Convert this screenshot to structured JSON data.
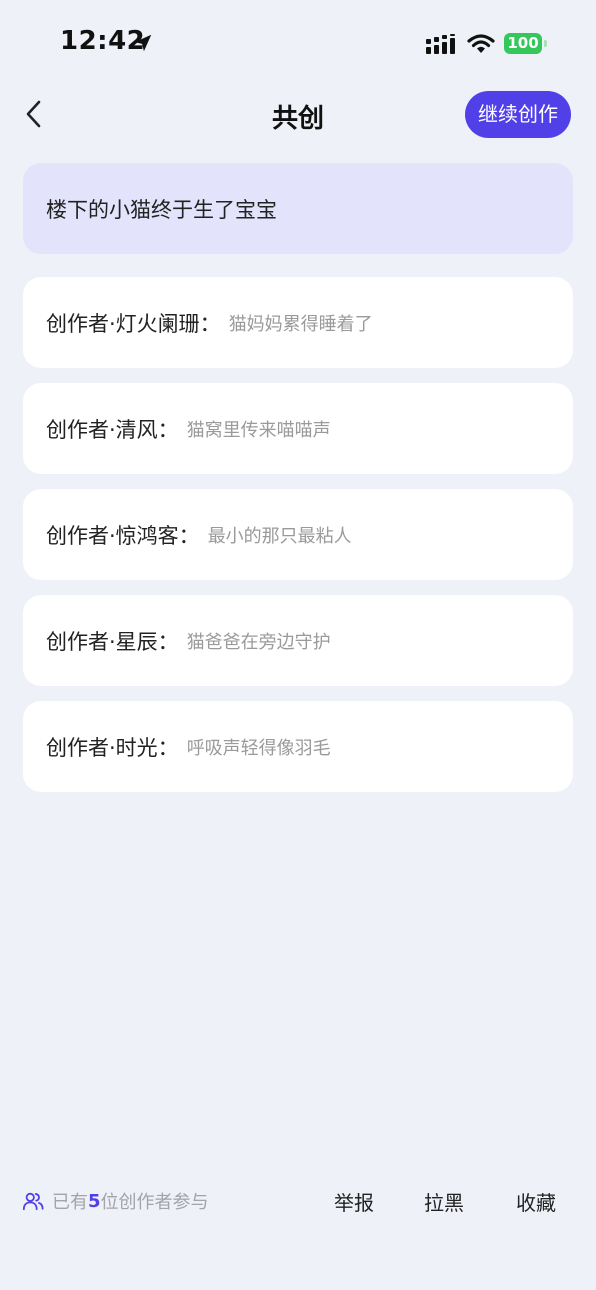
{
  "status_bar": {
    "time": "12:42",
    "battery": "100"
  },
  "header": {
    "title": "共创",
    "continue_label": "继续创作"
  },
  "topic": "楼下的小猫终于生了宝宝",
  "entries": [
    {
      "author": "创作者·灯火阑珊：",
      "text": "猫妈妈累得睡着了"
    },
    {
      "author": "创作者·清风：",
      "text": "猫窝里传来喵喵声"
    },
    {
      "author": "创作者·惊鸿客：",
      "text": "最小的那只最粘人"
    },
    {
      "author": "创作者·星辰：",
      "text": "猫爸爸在旁边守护"
    },
    {
      "author": "创作者·时光：",
      "text": "呼吸声轻得像羽毛"
    }
  ],
  "footer": {
    "participants_prefix": "已有",
    "participants_count": "5",
    "participants_suffix": "位创作者参与",
    "report_label": "举报",
    "block_label": "拉黑",
    "collect_label": "收藏"
  },
  "colors": {
    "accent": "#5140e8",
    "background": "#eef1f8",
    "topic_card": "#e3e4fb",
    "battery": "#34c759"
  },
  "icons": [
    "location-arrow-icon",
    "signal-icon",
    "wifi-icon",
    "back-chevron-icon",
    "users-icon"
  ]
}
